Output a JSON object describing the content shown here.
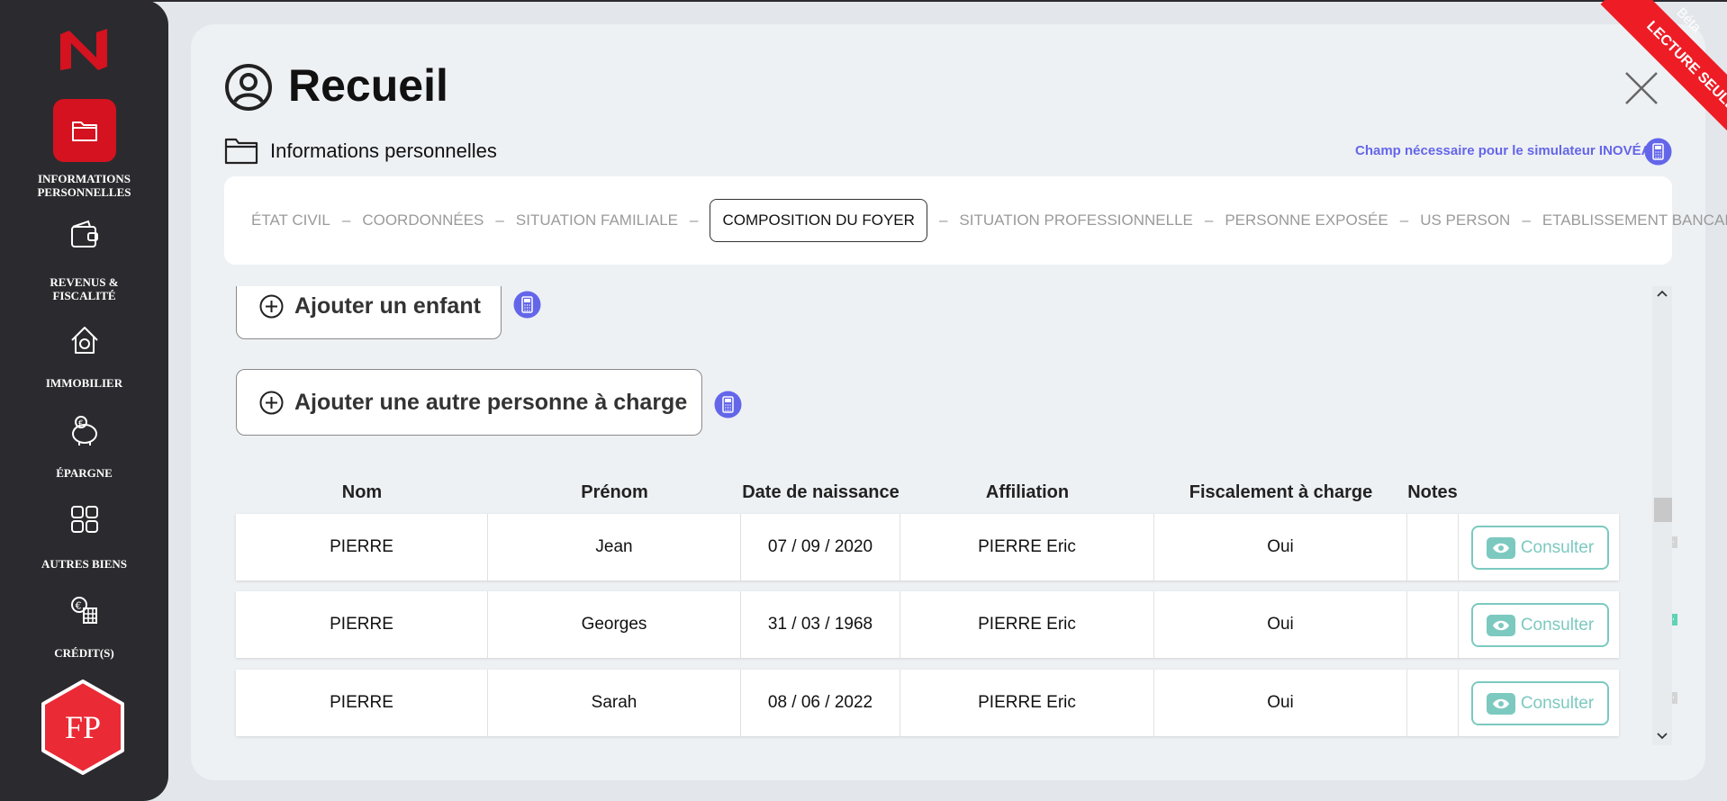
{
  "sidebar": {
    "items": [
      {
        "label_line1": "INFORMATIONS",
        "label_line2": "PERSONNELLES",
        "icon": "folder-icon",
        "active": true
      },
      {
        "label_line1": "REVENUS &",
        "label_line2": "FISCALITÉ",
        "icon": "wallet-icon"
      },
      {
        "label_line1": "IMMOBILIER",
        "label_line2": "",
        "icon": "house-icon"
      },
      {
        "label_line1": "ÉPARGNE",
        "label_line2": "",
        "icon": "piggy-bank-icon"
      },
      {
        "label_line1": "AUTRES BIENS",
        "label_line2": "",
        "icon": "grid-icon"
      },
      {
        "label_line1": "CRÉDIT(S)",
        "label_line2": "",
        "icon": "euro-calculator-icon"
      }
    ],
    "avatar_initials": "FP"
  },
  "header": {
    "title": "Recueil",
    "section_title": "Informations personnelles",
    "simulator_note": "Champ nécessaire pour le simulateur INOVÉA"
  },
  "ribbon": {
    "text": "LECTURE SEULE",
    "beta": "Béta"
  },
  "tabs": [
    {
      "label": "ÉTAT CIVIL"
    },
    {
      "label": "COORDONNÉES"
    },
    {
      "label": "SITUATION FAMILIALE"
    },
    {
      "label": "COMPOSITION DU FOYER",
      "active": true
    },
    {
      "label": "SITUATION PROFESSIONNELLE"
    },
    {
      "label": "PERSONNE EXPOSÉE"
    },
    {
      "label": "US PERSON"
    },
    {
      "label": "ETABLISSEMENT BANCAIRE"
    }
  ],
  "tab_separator": "–",
  "actions": {
    "add_child": "Ajouter un enfant",
    "add_dependent": "Ajouter une autre personne à charge"
  },
  "table": {
    "headers": [
      "Nom",
      "Prénom",
      "Date de naissance",
      "Affiliation",
      "Fiscalement à charge",
      "Notes"
    ],
    "consult_label": "Consulter",
    "rows": [
      {
        "nom": "PIERRE",
        "prenom": "Jean",
        "date": "07 / 09 / 2020",
        "affiliation": "PIERRE Eric",
        "fiscal": "Oui",
        "note_active": false
      },
      {
        "nom": "PIERRE",
        "prenom": "Georges",
        "date": "31 / 03 / 1968",
        "affiliation": "PIERRE Eric",
        "fiscal": "Oui",
        "note_active": true
      },
      {
        "nom": "PIERRE",
        "prenom": "Sarah",
        "date": "08 / 06 / 2022",
        "affiliation": "PIERRE Eric",
        "fiscal": "Oui",
        "note_active": false
      }
    ]
  },
  "colors": {
    "brand_red": "#d5121f",
    "accent_purple": "#6466e9",
    "consult_teal": "#7cc9c0",
    "note_active": "#5ed3b5",
    "note_inactive": "#d4d4d4"
  }
}
